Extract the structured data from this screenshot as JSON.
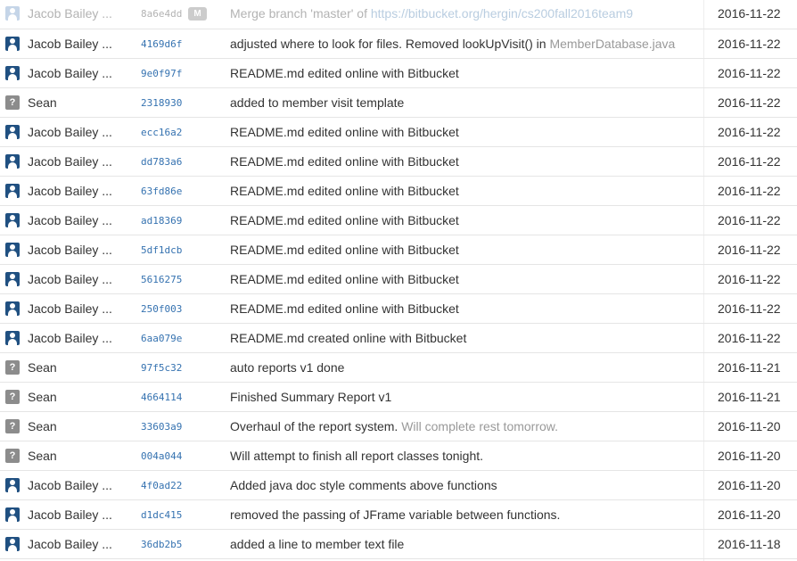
{
  "commits": [
    {
      "avatar": "user-icon",
      "author": "Jacob Bailey ...",
      "hash": "8a6e4dd",
      "badge": "M",
      "message": "Merge branch 'master' of ",
      "link": "https://bitbucket.org/hergin/cs200fall2016team9",
      "extra": "",
      "date": "2016-11-22",
      "faded": true
    },
    {
      "avatar": "user-icon",
      "author": "Jacob Bailey ...",
      "hash": "4169d6f",
      "message": "adjusted where to look for files. Removed lookUpVisit() in ",
      "extra": "MemberDatabase.java",
      "date": "2016-11-22"
    },
    {
      "avatar": "user-icon",
      "author": "Jacob Bailey ...",
      "hash": "9e0f97f",
      "message": "README.md edited online with Bitbucket",
      "extra": "",
      "date": "2016-11-22"
    },
    {
      "avatar": "unknown-user-icon",
      "author": "Sean",
      "hash": "2318930",
      "message": "added to member visit template",
      "extra": "",
      "date": "2016-11-22"
    },
    {
      "avatar": "user-icon",
      "author": "Jacob Bailey ...",
      "hash": "ecc16a2",
      "message": "README.md edited online with Bitbucket",
      "extra": "",
      "date": "2016-11-22"
    },
    {
      "avatar": "user-icon",
      "author": "Jacob Bailey ...",
      "hash": "dd783a6",
      "message": "README.md edited online with Bitbucket",
      "extra": "",
      "date": "2016-11-22"
    },
    {
      "avatar": "user-icon",
      "author": "Jacob Bailey ...",
      "hash": "63fd86e",
      "message": "README.md edited online with Bitbucket",
      "extra": "",
      "date": "2016-11-22"
    },
    {
      "avatar": "user-icon",
      "author": "Jacob Bailey ...",
      "hash": "ad18369",
      "message": "README.md edited online with Bitbucket",
      "extra": "",
      "date": "2016-11-22"
    },
    {
      "avatar": "user-icon",
      "author": "Jacob Bailey ...",
      "hash": "5df1dcb",
      "message": "README.md edited online with Bitbucket",
      "extra": "",
      "date": "2016-11-22"
    },
    {
      "avatar": "user-icon",
      "author": "Jacob Bailey ...",
      "hash": "5616275",
      "message": "README.md edited online with Bitbucket",
      "extra": "",
      "date": "2016-11-22"
    },
    {
      "avatar": "user-icon",
      "author": "Jacob Bailey ...",
      "hash": "250f003",
      "message": "README.md edited online with Bitbucket",
      "extra": "",
      "date": "2016-11-22"
    },
    {
      "avatar": "user-icon",
      "author": "Jacob Bailey ...",
      "hash": "6aa079e",
      "message": "README.md created online with Bitbucket",
      "extra": "",
      "date": "2016-11-22"
    },
    {
      "avatar": "unknown-user-icon",
      "author": "Sean",
      "hash": "97f5c32",
      "message": "auto reports v1 done",
      "extra": "",
      "date": "2016-11-21"
    },
    {
      "avatar": "unknown-user-icon",
      "author": "Sean",
      "hash": "4664114",
      "message": "Finished Summary Report v1",
      "extra": "",
      "date": "2016-11-21"
    },
    {
      "avatar": "unknown-user-icon",
      "author": "Sean",
      "hash": "33603a9",
      "message": "Overhaul of the report system. ",
      "extra": "Will complete rest tomorrow.",
      "date": "2016-11-20"
    },
    {
      "avatar": "unknown-user-icon",
      "author": "Sean",
      "hash": "004a044",
      "message": "Will attempt to finish all report classes tonight.",
      "extra": "",
      "date": "2016-11-20"
    },
    {
      "avatar": "user-icon",
      "author": "Jacob Bailey ...",
      "hash": "4f0ad22",
      "message": "Added java doc style comments above functions",
      "extra": "",
      "date": "2016-11-20"
    },
    {
      "avatar": "user-icon",
      "author": "Jacob Bailey ...",
      "hash": "d1dc415",
      "message": "removed the passing of JFrame variable between functions.",
      "extra": "",
      "date": "2016-11-20"
    },
    {
      "avatar": "user-icon",
      "author": "Jacob Bailey ...",
      "hash": "36db2b5",
      "message": "added a line to member text file",
      "extra": "",
      "date": "2016-11-18"
    }
  ],
  "colors": {
    "link": "#3572b0",
    "avatar_user": "#205081",
    "avatar_unknown": "#8c8c8c",
    "muted_text": "#999999",
    "row_border": "#e5e5e5"
  }
}
